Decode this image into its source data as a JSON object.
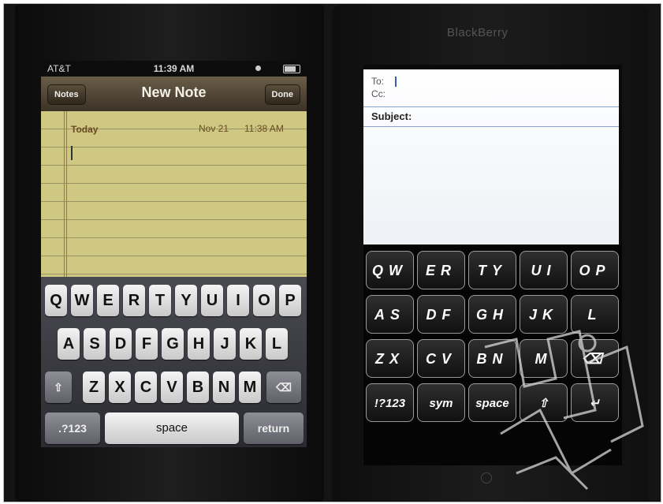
{
  "iphone": {
    "status": {
      "carrier": "AT&T",
      "time": "11:39 AM"
    },
    "navbar": {
      "left_button": "Notes",
      "title": "New Note",
      "right_button": "Done"
    },
    "note": {
      "header_label": "Today",
      "date": "Nov 21",
      "time": "11:38 AM"
    },
    "keyboard": {
      "row1": [
        "Q",
        "W",
        "E",
        "R",
        "T",
        "Y",
        "U",
        "I",
        "O",
        "P"
      ],
      "row2": [
        "A",
        "S",
        "D",
        "F",
        "G",
        "H",
        "J",
        "K",
        "L"
      ],
      "row3": [
        "Z",
        "X",
        "C",
        "V",
        "B",
        "N",
        "M"
      ],
      "numbers_key": ".?123",
      "space_key": "space",
      "return_key": "return"
    }
  },
  "blackberry": {
    "brand": "BlackBerry",
    "email": {
      "to_label": "To:",
      "cc_label": "Cc:",
      "subject_label": "Subject:"
    },
    "keyboard": {
      "keys": [
        "QW",
        "ER",
        "TY",
        "UI",
        "OP",
        "AS",
        "DF",
        "GH",
        "JK",
        "L",
        "ZX",
        "CV",
        "BN",
        "M",
        "",
        "!?123",
        "sym",
        "space",
        "",
        ""
      ]
    }
  }
}
